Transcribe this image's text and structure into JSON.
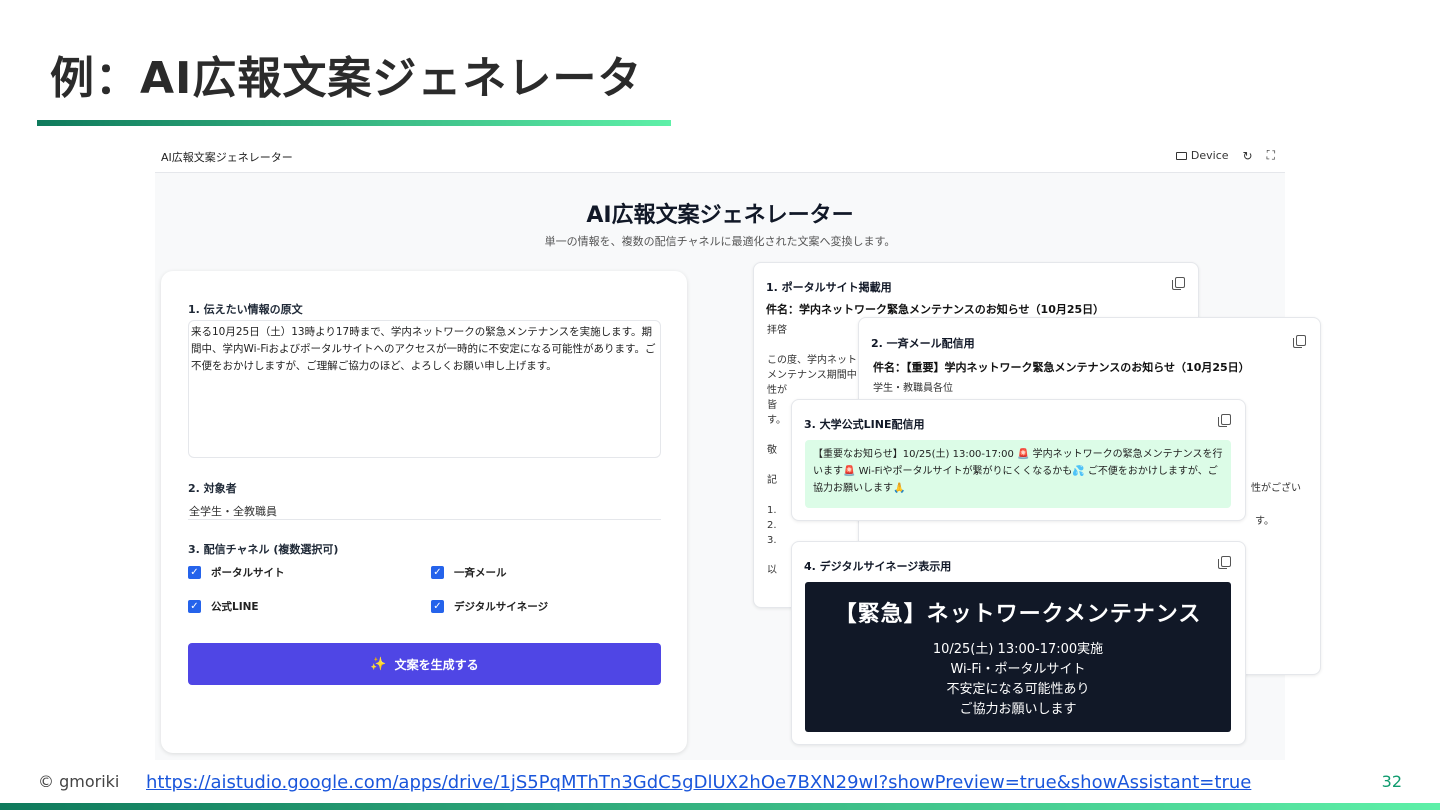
{
  "slide": {
    "title": "例：AI広報文案ジェネレータ",
    "copyright": "© gmoriki",
    "link": "https://aistudio.google.com/apps/drive/1jS5PqMThTn3GdC5gDlUX2hOe7BXN29wI?showPreview=true&showAssistant=true",
    "page_number": "32"
  },
  "app": {
    "topbar_name": "AI広報文案ジェネレーター",
    "device_label": "Device",
    "refresh_icon": "refresh-icon",
    "fullscreen_icon": "fullscreen-icon",
    "title": "AI広報文案ジェネレーター",
    "subtitle": "単一の情報を、複数の配信チャネルに最適化された文案へ変換します。"
  },
  "form": {
    "source_label": "1. 伝えたい情報の原文",
    "source_text": "来る10月25日（土）13時より17時まで、学内ネットワークの緊急メンテナンスを実施します。期間中、学内Wi-Fiおよびポータルサイトへのアクセスが一時的に不安定になる可能性があります。ご不便をおかけしますが、ご理解ご協力のほど、よろしくお願い申し上げます。",
    "audience_label": "2. 対象者",
    "audience_value": "全学生・全教職員",
    "channels_label": "3. 配信チャネル (複数選択可)",
    "channels": [
      {
        "label": "ポータルサイト",
        "checked": true
      },
      {
        "label": "一斉メール",
        "checked": true
      },
      {
        "label": "公式LINE",
        "checked": true
      },
      {
        "label": "デジタルサイネージ",
        "checked": true
      }
    ],
    "generate_label": "文案を生成する"
  },
  "outputs": {
    "portal": {
      "title": "1. ポータルサイト掲載用",
      "subject": "件名：学内ネットワーク緊急メンテナンスのお知らせ（10月25日）",
      "body": "拝啓\n\nこの度、学内ネット\nメンテナンス期間中\n性が\n皆\nす。\n\n敬\n\n記\n\n1.\n2.\n3.\n\n以"
    },
    "mail": {
      "title": "2. 一斉メール配信用",
      "subject": "件名：【重要】学内ネットワーク緊急メンテナンスのお知らせ（10月25日）",
      "body": "学生・教職員各位",
      "tail1": "性がござい",
      "tail2": "す。"
    },
    "line": {
      "title": "3. 大学公式LINE配信用",
      "message": "【重要なお知らせ】10/25(土) 13:00-17:00 🚨 学内ネットワークの緊急メンテナンスを行います🚨 Wi-Fiやポータルサイトが繋がりにくくなるかも💦 ご不便をおかけしますが、ご協力お願いします🙏"
    },
    "signage": {
      "title": "4. デジタルサイネージ表示用",
      "headline": "【緊急】ネットワークメンテナンス",
      "lines": [
        "10/25(土) 13:00-17:00実施",
        "Wi-Fi・ポータルサイト",
        "不安定になる可能性あり",
        "ご協力お願いします"
      ]
    }
  },
  "colors": {
    "accent": "#4f46e5",
    "checkbox": "#2563eb",
    "line_bg": "#dcfce7",
    "signage_bg": "#111827",
    "brand_green": "#0f7a5c"
  }
}
